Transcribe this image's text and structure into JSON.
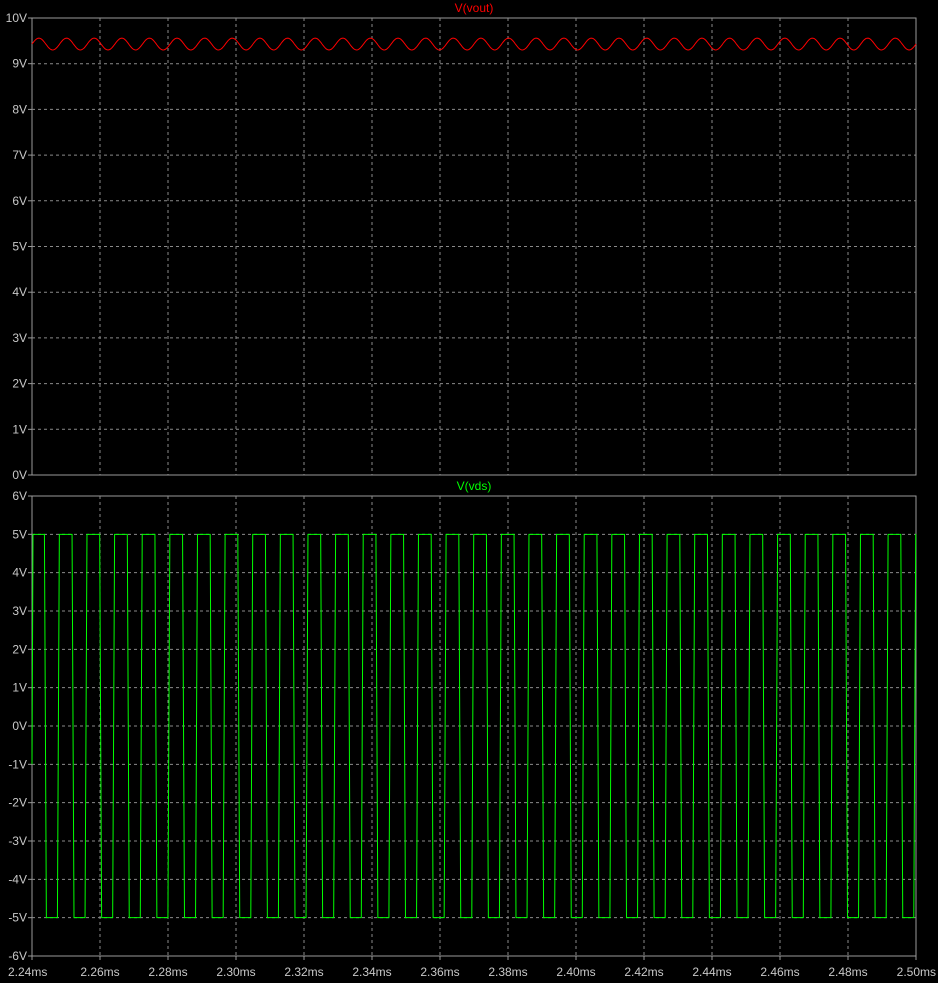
{
  "chart_data": [
    {
      "type": "line",
      "title": "V(vout)",
      "color": "#ff0000",
      "xlim": [
        2.24,
        2.5
      ],
      "x_unit": "ms",
      "ylim": [
        0,
        10
      ],
      "y_ticks": [
        "0V",
        "1V",
        "2V",
        "3V",
        "4V",
        "5V",
        "6V",
        "7V",
        "8V",
        "9V",
        "10V"
      ],
      "grid": true,
      "series": [
        {
          "name": "V(vout)",
          "waveform": "ripple",
          "mean": 9.43,
          "amplitude": 0.13,
          "cycles": 32
        }
      ]
    },
    {
      "type": "line",
      "title": "V(vds)",
      "color": "#00ff00",
      "xlim": [
        2.24,
        2.5
      ],
      "x_unit": "ms",
      "ylim": [
        -6,
        6
      ],
      "y_ticks": [
        "-6V",
        "-5V",
        "-4V",
        "-3V",
        "-2V",
        "-1V",
        "0V",
        "1V",
        "2V",
        "3V",
        "4V",
        "5V",
        "6V"
      ],
      "x_ticks": [
        "2.24ms",
        "2.26ms",
        "2.28ms",
        "2.30ms",
        "2.32ms",
        "2.34ms",
        "2.36ms",
        "2.38ms",
        "2.40ms",
        "2.42ms",
        "2.44ms",
        "2.46ms",
        "2.48ms",
        "2.50ms"
      ],
      "grid": true,
      "series": [
        {
          "name": "V(vds)",
          "waveform": "square",
          "high": 5,
          "low": -5,
          "cycles": 32,
          "start_value": -1
        }
      ]
    }
  ]
}
